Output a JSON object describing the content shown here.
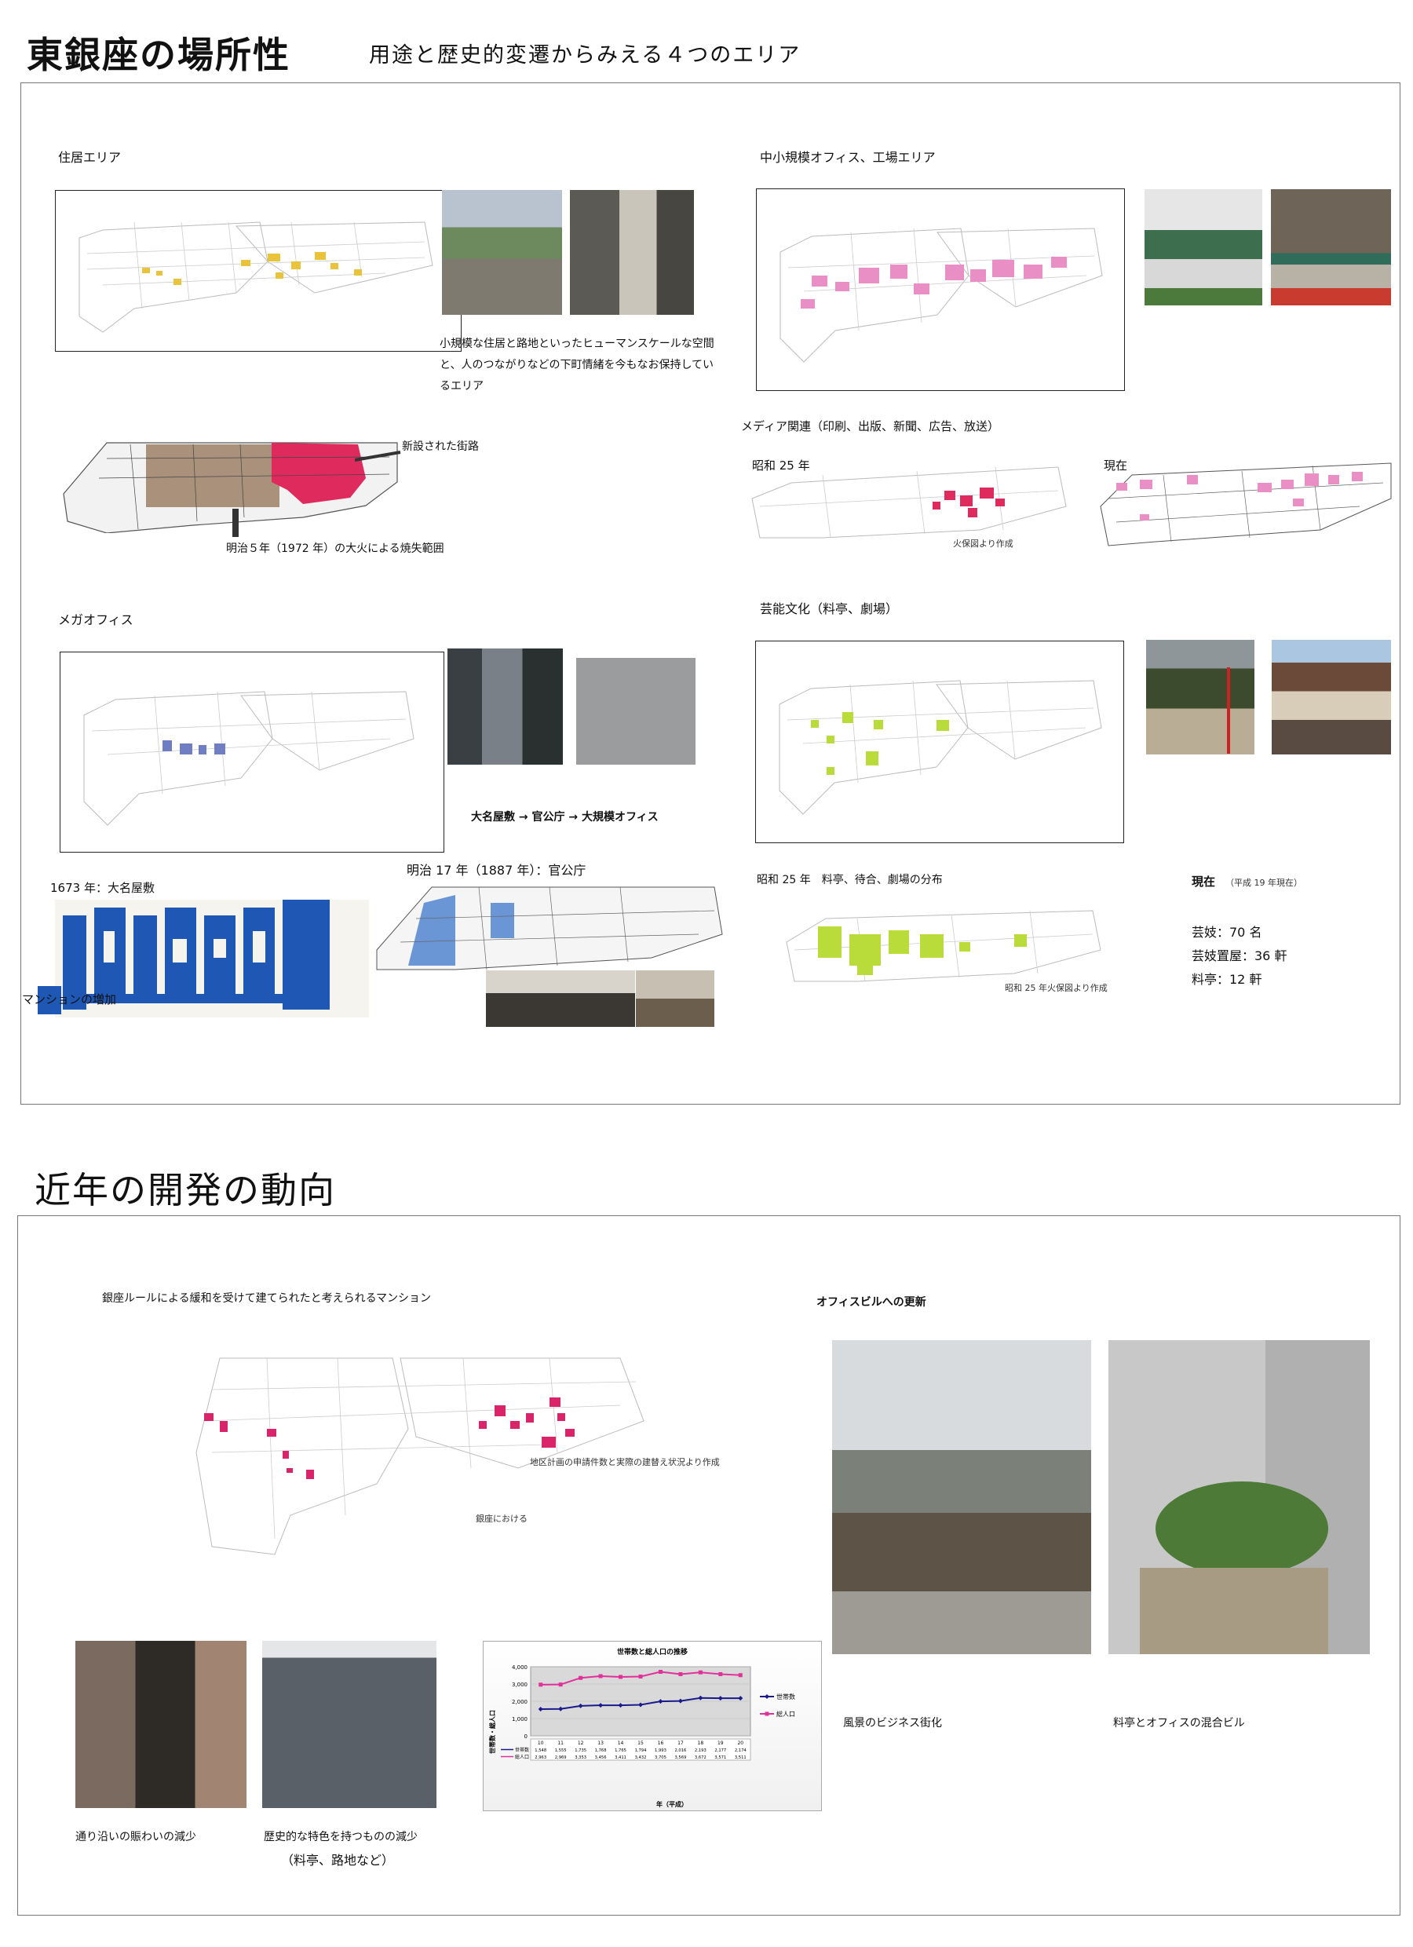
{
  "section1": {
    "title": "東銀座の場所性",
    "subtitle": "用途と歴史的変遷からみえる４つのエリア",
    "residential": {
      "heading": "住居エリア",
      "description": "小規模な住居と路地といったヒューマンスケールな空間と、人のつながりなどの下町情緒を今もなお保持しているエリア",
      "new_street": "新設された街路",
      "fire_caption": "明治５年（1972 年）の大火による焼失範囲"
    },
    "smalloffice": {
      "heading": "中小規模オフィス、工場エリア",
      "media": "メディア関連（印刷、出版、新聞、広告、放送）",
      "showa25": "昭和 25 年",
      "now": "現在",
      "source": "火保図より作成"
    },
    "megaoffice": {
      "heading": "メガオフィス",
      "flow": "大名屋敷 → 官公庁 → 大規模オフィス",
      "y1673": "1673 年：大名屋敷",
      "meiji17": "明治 17 年（1887 年）：官公庁",
      "mansion": "マンションの増加"
    },
    "culture": {
      "heading": "芸能文化（料亭、劇場）",
      "distribution": "昭和 25 年　料亭、待合、劇場の分布",
      "source": "昭和 25 年火保図より作成",
      "now": "現在",
      "now_note": "（平成 19 年現在）",
      "geisha": "芸妓：70 名",
      "okiya": "芸妓置屋：36 軒",
      "ryotei": "料亭：12 軒"
    }
  },
  "section2": {
    "title": "近年の開発の動向",
    "mansion_heading": "銀座ルールによる緩和を受けて建てられたと考えられるマンション",
    "map_source": "地区計画の申請件数と実際の建替え状況より作成",
    "ginza_note": "銀座における",
    "office_heading": "オフィスビルへの更新",
    "photo1_caption": "風景のビジネス街化",
    "photo2_caption": "料亭とオフィスの混合ビル",
    "street_caption": "通り沿いの賑わいの減少",
    "historic_caption_1": "歴史的な特色を持つものの減少",
    "historic_caption_2": "（料亭、路地など）"
  },
  "colors": {
    "residential": "#e9c43a",
    "smalloffice": "#ea8fc6",
    "fire": "#de2a5c",
    "burnt": "#a9917b",
    "megaoffice": "#6f7ec2",
    "daimyo": "#1f57b5",
    "culture": "#b9dc3a",
    "mansion": "#d9246a",
    "households_line": "#1a1a8c",
    "population_line": "#e0309a"
  },
  "chart_data": {
    "type": "line",
    "title": "世帯数と総人口の推移",
    "xlabel": "年（平成）",
    "ylabel": "世帯数・総人口",
    "categories": [
      "10",
      "11",
      "12",
      "13",
      "14",
      "15",
      "16",
      "17",
      "18",
      "19",
      "20"
    ],
    "ylim": [
      0,
      4000
    ],
    "yticks": [
      "0",
      "1,000",
      "2,000",
      "3,000",
      "4,000"
    ],
    "series": [
      {
        "name": "世帯数",
        "values": [
          1548,
          1555,
          1735,
          1768,
          1765,
          1794,
          1993,
          2016,
          2193,
          2177,
          2174
        ],
        "labels": [
          "1,548",
          "1,555",
          "1,735",
          "1,768",
          "1,765",
          "1,794",
          "1,993",
          "2,016",
          "2,193",
          "2,177",
          "2,174"
        ]
      },
      {
        "name": "総人口",
        "values": [
          2963,
          2969,
          3353,
          3456,
          3411,
          3432,
          3705,
          3569,
          3672,
          3571,
          3511
        ],
        "labels": [
          "2,963",
          "2,969",
          "3,353",
          "3,456",
          "3,411",
          "3,432",
          "3,705",
          "3,569",
          "3,672",
          "3,571",
          "3,511"
        ]
      }
    ]
  }
}
